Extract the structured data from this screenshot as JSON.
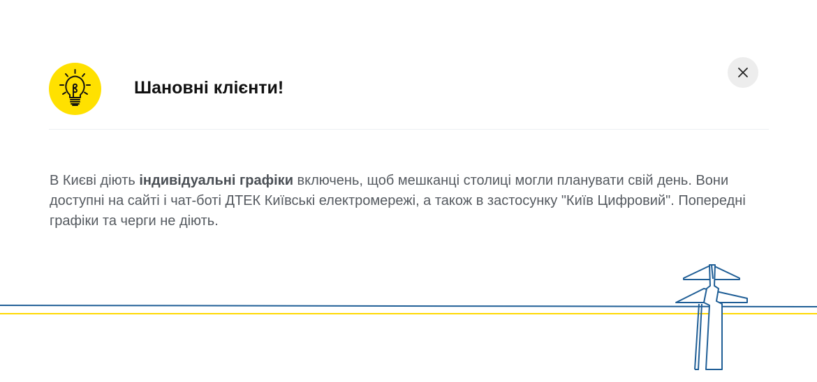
{
  "dialog": {
    "title": "Шановні клієнти!",
    "icon": "lightbulb-icon",
    "close_icon": "close-icon",
    "message": {
      "part1": "В Києві діють ",
      "bold": "індивідуальні графіки",
      "part2": " включень, щоб мешканці столиці могли планувати свій день. Вони доступні на сайті і чат-боті ДТЕК Київські електромережі, а також в застосунку \"Київ Цифровий\". Попередні графіки та черги не діють."
    }
  },
  "colors": {
    "accent_yellow": "#ffe100",
    "line_blue": "#1f5e96",
    "close_bg": "#ededed",
    "text": "#555a60"
  }
}
